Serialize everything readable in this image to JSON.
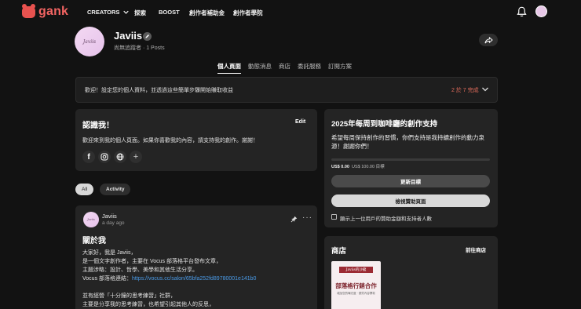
{
  "nav": {
    "logo": "gank",
    "links": [
      "CREATORS",
      "探索",
      "BOOST",
      "創作者補助金",
      "創作者學院"
    ]
  },
  "profile": {
    "avatar_text": "Javiis",
    "name": "Javiis",
    "subtitle": "尚無追蹤者  ·  1 Posts"
  },
  "tabs": [
    "個人頁面",
    "動態消息",
    "商店",
    "委託服務",
    "訂閱方案"
  ],
  "setup": {
    "message": "歡迎！設定您的個人資料，並透過這些簡單步驟開始賺取收益",
    "progress": "2 於 7 完成"
  },
  "about": {
    "title": "認識我！",
    "edit": "Edit",
    "text": "歡迎來到我的個人頁面。如果你喜歡我的內容，請支持我的創作。謝謝！",
    "socials": [
      "facebook-icon",
      "instagram-icon",
      "globe-icon",
      "add-icon"
    ]
  },
  "filters": {
    "all": "All",
    "activity": "Activity"
  },
  "post": {
    "avatar_text": "Javiis",
    "author": "Javiis",
    "time": "a day ago",
    "title": "關於我",
    "lines": [
      "大家好，我是 Javiis，",
      "是一個文字創作者，主要在 Vocus 部落格平台發布文章，",
      "主題涉略：設計、哲學、美學和其他生活分享。",
      "Vocus 部落格連結：",
      "",
      "並有經營「十分鐘的思考練習」社群，",
      "主要是分享我的思考練習，也希望引起其他人的反思，"
    ],
    "link": "https://vocus.cc/salon/65bfa252fd89780001e141b0"
  },
  "goal": {
    "title": "2025年每周到咖啡廳的創作支持",
    "description": "希望每周保持創作的習慣，你們支持是我持續創作的動力泉源！謝謝你們！",
    "current": "US$ 0.00",
    "target": "US$ 100.00 目標",
    "progress_fraction": 0,
    "update_button": "更新目標",
    "view_button": "檢視贊助頁面",
    "checkbox_label": "顯示上一位用戶的贊助金額和支持者人數"
  },
  "shop": {
    "title": "商店",
    "link": "前往商店",
    "product": {
      "header": "Javiis的沙龍",
      "title": "部落格行銷合作",
      "subtitle": "增加您的曝光度  ·  優質內容撰寫"
    }
  }
}
